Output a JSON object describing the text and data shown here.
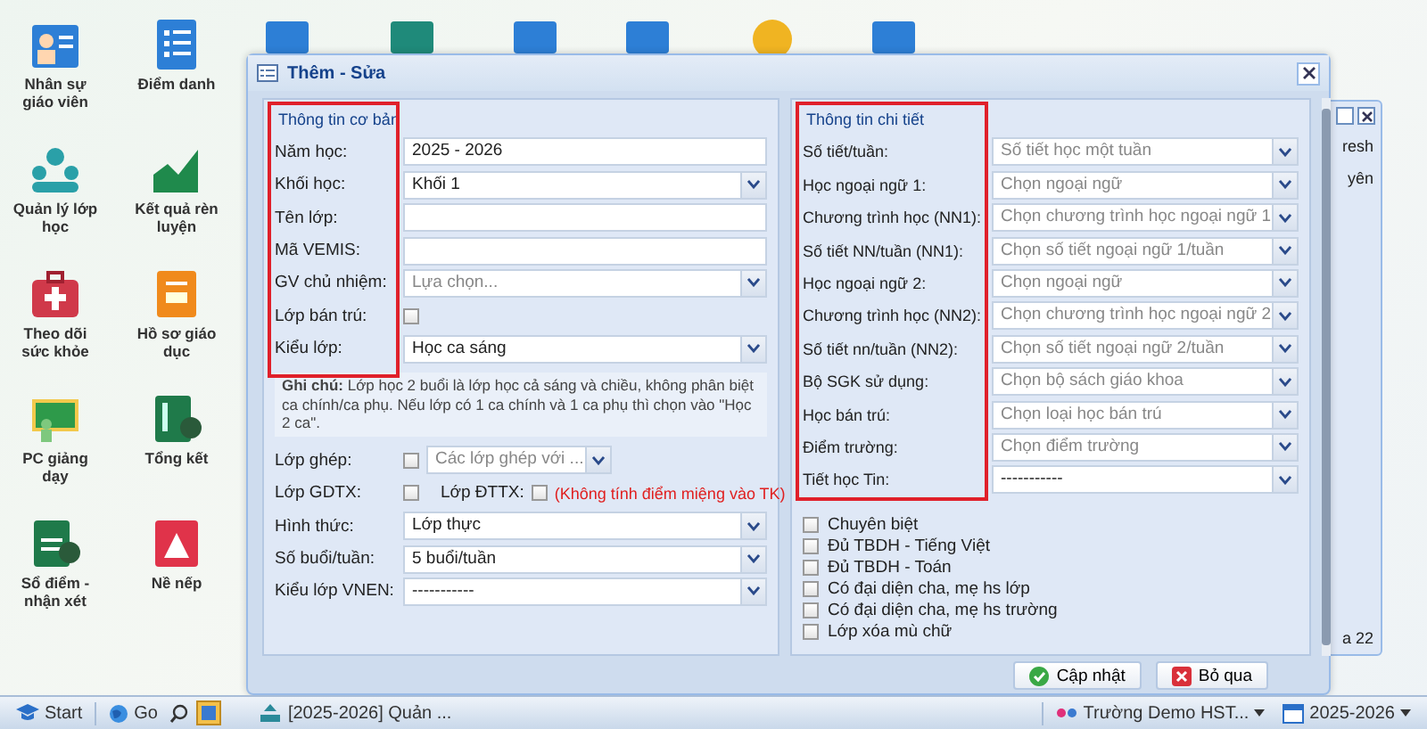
{
  "desktop_icons": [
    {
      "label": "Nhân sự giáo viên",
      "kind": "person"
    },
    {
      "label": "Điểm danh",
      "kind": "list"
    },
    {
      "label": "Quản lý lớp học",
      "kind": "group"
    },
    {
      "label": "Kết quả rèn luyện",
      "kind": "chart"
    },
    {
      "label": "Theo dõi sức khỏe",
      "kind": "medical"
    },
    {
      "label": "Hồ sơ giáo dục",
      "kind": "folder"
    },
    {
      "label": "PC giảng dạy",
      "kind": "board"
    },
    {
      "label": "Tổng kết",
      "kind": "summary"
    },
    {
      "label": "Sổ điểm - nhận xét",
      "kind": "gradebook"
    },
    {
      "label": "Nề nếp",
      "kind": "warning"
    }
  ],
  "background_window": {
    "texts": [
      "resh",
      "yên",
      "a 22"
    ]
  },
  "dialog": {
    "title": "Thêm - Sửa",
    "basic": {
      "legend": "Thông tin cơ bản",
      "fields": [
        {
          "label": "Năm học:",
          "kind": "text",
          "value": "2025 - 2026"
        },
        {
          "label": "Khối học:",
          "kind": "select",
          "value": "Khối 1"
        },
        {
          "label": "Tên lớp:",
          "kind": "text"
        },
        {
          "label": "Mã VEMIS:",
          "kind": "text"
        },
        {
          "label": "GV chủ nhiệm:",
          "kind": "select",
          "placeholder": "Lựa chọn..."
        },
        {
          "label": "Lớp bán trú:",
          "kind": "checkbox",
          "checked": false
        },
        {
          "label": "Kiểu lớp:",
          "kind": "select",
          "value": "Học ca sáng"
        }
      ],
      "note": "**Ghi chú:** Lớp học 2 buổi là lớp học cả sáng và chiều, không phân biệt ca chính/ca phụ. Nếu lớp có 1 ca chính và 1 ca phụ thì chọn vào \"Học 2 ca\".",
      "more_fields": [
        {
          "label": "Lớp ghép:",
          "kind": "checkbox_select",
          "checked": false,
          "placeholder": "Các lớp ghép với ..."
        },
        {
          "label": "Lớp GDTX:",
          "kind": "checkbox_pair",
          "checked": false,
          "second_label": "Lớp ĐTTX:",
          "second_checked": false,
          "warning": "(Không tính điểm miệng vào TK)"
        },
        {
          "label": "Hình thức:",
          "kind": "select",
          "value": "Lớp thực"
        },
        {
          "label": "Số buổi/tuần:",
          "kind": "select",
          "value": "5 buổi/tuần"
        },
        {
          "label": "Kiểu lớp VNEN:",
          "kind": "select",
          "value": "-----------"
        }
      ]
    },
    "detail": {
      "legend": "Thông tin chi tiết",
      "fields": [
        {
          "label": "Số tiết/tuần:",
          "kind": "select",
          "placeholder": "Số tiết học một tuần"
        },
        {
          "label": "Học ngoại ngữ 1:",
          "kind": "select",
          "placeholder": "Chọn ngoại ngữ"
        },
        {
          "label": "Chương trình học (NN1):",
          "kind": "select",
          "placeholder": "Chọn chương trình học ngoại ngữ 1"
        },
        {
          "label": "Số tiết NN/tuần (NN1):",
          "kind": "select",
          "placeholder": "Chọn số tiết ngoại ngữ 1/tuần"
        },
        {
          "label": "Học ngoại ngữ 2:",
          "kind": "select",
          "placeholder": "Chọn ngoại ngữ"
        },
        {
          "label": "Chương trình học (NN2):",
          "kind": "select",
          "placeholder": "Chọn chương trình học ngoại ngữ 2"
        },
        {
          "label": "Số tiết nn/tuần (NN2):",
          "kind": "select",
          "placeholder": "Chọn số tiết ngoại ngữ 2/tuần"
        },
        {
          "label": "Bộ SGK sử dụng:",
          "kind": "select",
          "placeholder": "Chọn bộ sách giáo khoa"
        },
        {
          "label": "Học bán trú:",
          "kind": "select",
          "placeholder": "Chọn loại học bán trú"
        },
        {
          "label": "Điểm trường:",
          "kind": "select",
          "placeholder": "Chọn điểm trường"
        },
        {
          "label": "Tiết học Tin:",
          "kind": "select",
          "value": "-----------"
        }
      ],
      "options": [
        {
          "label": "Chuyên biệt",
          "checked": false
        },
        {
          "label": "Đủ TBDH - Tiếng Việt",
          "checked": false
        },
        {
          "label": "Đủ TBDH - Toán",
          "checked": false
        },
        {
          "label": "Có đại diện cha, mẹ hs lớp",
          "checked": false
        },
        {
          "label": "Có đại diện cha, mẹ hs trường",
          "checked": false
        },
        {
          "label": "Lớp xóa mù chữ",
          "checked": false
        }
      ]
    },
    "buttons": [
      {
        "label": "Cập nhật",
        "kind": "save"
      },
      {
        "label": "Bỏ qua",
        "kind": "cancel"
      }
    ]
  },
  "taskbar": {
    "start": "Start",
    "go": "Go",
    "window": "[2025-2026] Quản ...",
    "school": "Trường Demo HST...",
    "year": "2025-2026"
  }
}
